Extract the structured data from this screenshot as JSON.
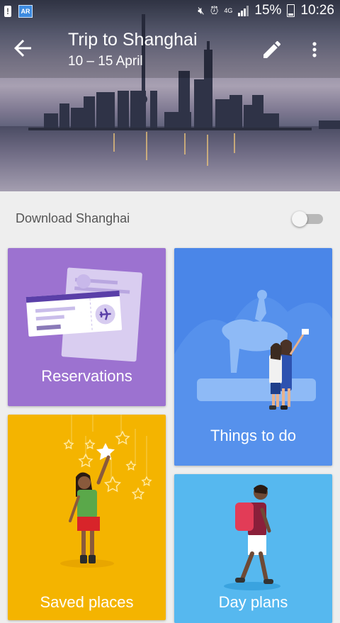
{
  "status_bar": {
    "left_icons": [
      "alert-icon",
      "ar-app-icon"
    ],
    "ar_text": "AR",
    "right_icons": [
      "mute-icon",
      "alarm-icon",
      "signal-icon",
      "battery-icon"
    ],
    "network": "4G",
    "battery": "15%",
    "time": "10:26"
  },
  "header": {
    "title": "Trip to Shanghai",
    "dates": "10 – 15 April",
    "back_icon": "arrow-left-icon",
    "edit_icon": "pencil-icon",
    "more_icon": "more-vert-icon"
  },
  "download": {
    "label": "Download Shanghai",
    "enabled": false
  },
  "cards": {
    "reservations": "Reservations",
    "things_to_do": "Things to do",
    "saved_places": "Saved places",
    "day_plans": "Day plans"
  },
  "colors": {
    "reservations": "#9c72d0",
    "things_to_do": "#4a86e8",
    "saved_places": "#f4b400",
    "day_plans": "#56b8ef"
  }
}
